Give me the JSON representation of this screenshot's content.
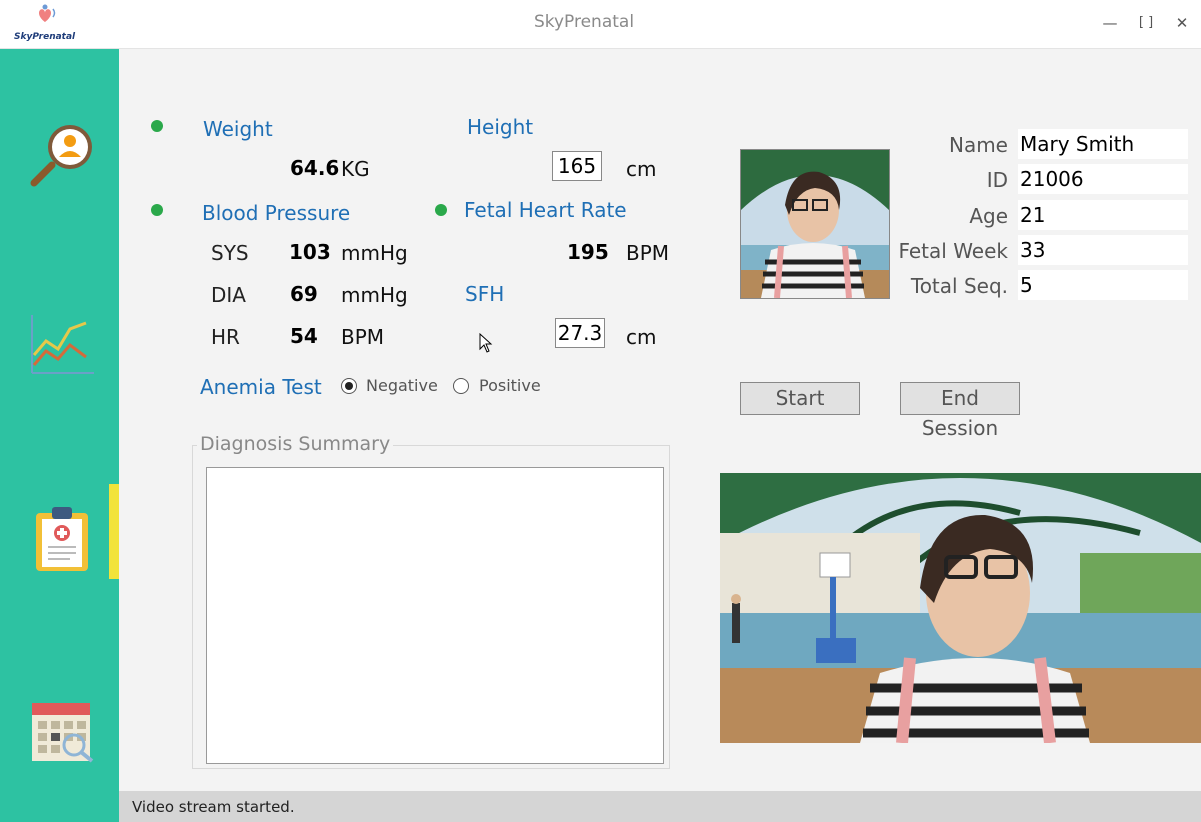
{
  "window": {
    "title": "SkyPrenatal",
    "logo_text": "SkyPrenatal"
  },
  "sidebar": {
    "items": [
      {
        "icon": "patient-search-icon"
      },
      {
        "icon": "chart-icon"
      },
      {
        "icon": "clipboard-icon",
        "active": true
      },
      {
        "icon": "calendar-search-icon"
      }
    ]
  },
  "vitals": {
    "weight": {
      "label": "Weight",
      "value": "64.6",
      "unit": "KG"
    },
    "height": {
      "label": "Height",
      "value": "165",
      "unit": "cm"
    },
    "blood_pressure": {
      "label": "Blood Pressure",
      "sys": {
        "label": "SYS",
        "value": "103",
        "unit": "mmHg"
      },
      "dia": {
        "label": "DIA",
        "value": "69",
        "unit": "mmHg"
      },
      "hr": {
        "label": "HR",
        "value": "54",
        "unit": "BPM"
      }
    },
    "fetal_heart_rate": {
      "label": "Fetal Heart Rate",
      "value": "195",
      "unit": "BPM"
    },
    "sfh": {
      "label": "SFH",
      "value": "27.3",
      "unit": "cm"
    },
    "anemia_test": {
      "label": "Anemia Test",
      "options": [
        "Negative",
        "Positive"
      ],
      "selected": "Negative"
    }
  },
  "diagnosis": {
    "label": "Diagnosis Summary",
    "value": ""
  },
  "patient": {
    "name_label": "Name",
    "name": "Mary Smith",
    "id_label": "ID",
    "id": "21006",
    "age_label": "Age",
    "age": "21",
    "fetal_week_label": "Fetal Week",
    "fetal_week": "33",
    "total_seq_label": "Total Seq.",
    "total_seq": "5"
  },
  "buttons": {
    "start": "Start",
    "end_session": "End Session"
  },
  "status": {
    "text": "Video stream started."
  },
  "colors": {
    "sidebar": "#2dc2a2",
    "accent_label": "#1f6fb5",
    "indicator": "#2aa84a",
    "active_marker": "#f2e33b"
  }
}
